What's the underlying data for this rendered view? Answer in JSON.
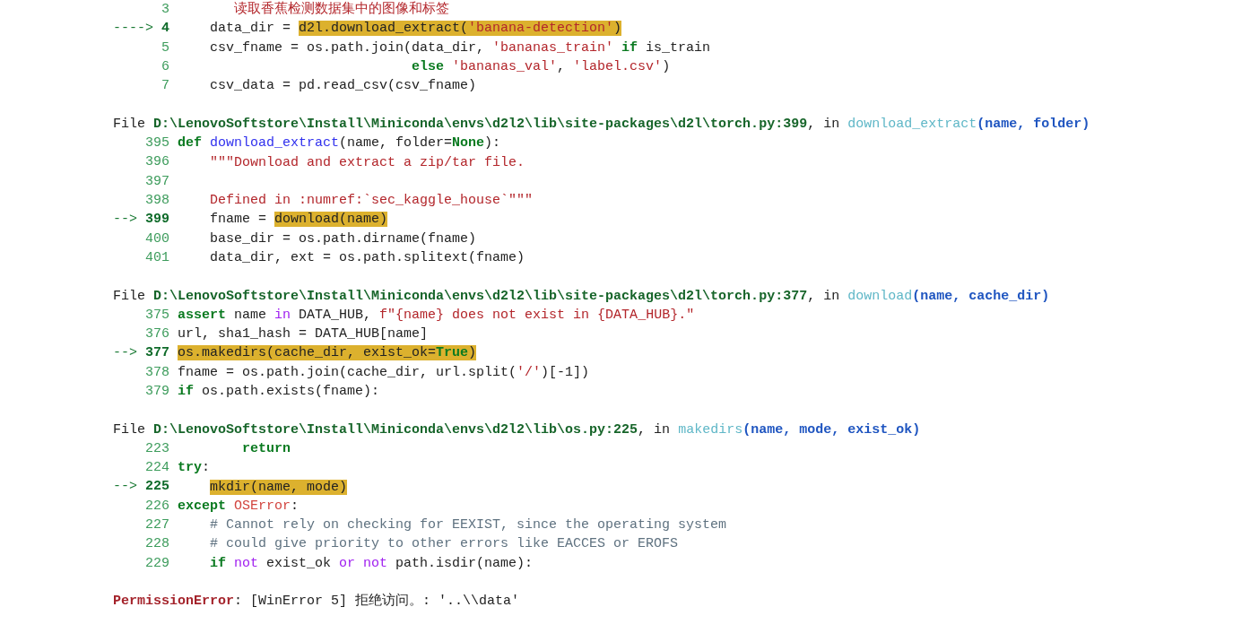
{
  "lines": [
    {
      "kind": "code",
      "current": false,
      "number": "3",
      "code": [
        {
          "kind": "s",
          "text": "       读取香蕉检测数据集中的图像和标签"
        }
      ]
    },
    {
      "kind": "code",
      "current": true,
      "arrow": "---->",
      "number": "4",
      "code": [
        {
          "kind": "p",
          "text": "    data_dir = "
        }
      ],
      "highlight": [
        {
          "kind": "p",
          "text": "d2l.download_extract("
        },
        {
          "kind": "s",
          "text": "'banana-detection'"
        },
        {
          "kind": "p",
          "text": ")"
        }
      ]
    },
    {
      "kind": "code",
      "current": false,
      "number": "5",
      "code": [
        {
          "kind": "p",
          "text": "    csv_fname = os.path.join(data_dir, "
        },
        {
          "kind": "s",
          "text": "'bananas_train'"
        },
        {
          "kind": "kw",
          "text": " if"
        },
        {
          "kind": "p",
          "text": " is_train"
        }
      ]
    },
    {
      "kind": "code",
      "current": false,
      "number": "6",
      "code": [
        {
          "kind": "kw",
          "text": "                             else"
        },
        {
          "kind": "s",
          "text": " 'bananas_val'"
        },
        {
          "kind": "p",
          "text": ", "
        },
        {
          "kind": "s",
          "text": "'label.csv'"
        },
        {
          "kind": "p",
          "text": ")"
        }
      ]
    },
    {
      "kind": "code",
      "current": false,
      "number": "7",
      "code": [
        {
          "kind": "p",
          "text": "    csv_data = pd.read_csv(csv_fname)"
        }
      ]
    },
    {
      "kind": "blank"
    },
    {
      "kind": "header",
      "code": [
        {
          "kind": "p",
          "text": "File "
        },
        {
          "kind": "path",
          "text": "D:\\LenovoSoftstore\\Install\\Miniconda\\envs\\d2l2\\lib\\site-packages\\d2l\\torch.py:399"
        },
        {
          "kind": "p",
          "text": ", in "
        },
        {
          "kind": "tfn",
          "text": "download_extract"
        },
        {
          "kind": "args",
          "text": "(name, folder)"
        }
      ]
    },
    {
      "kind": "code",
      "current": false,
      "number": "395",
      "code": [
        {
          "kind": "kw",
          "text": "def"
        },
        {
          "kind": "fn",
          "text": " download_extract"
        },
        {
          "kind": "p",
          "text": "(name, folder="
        },
        {
          "kind": "kw",
          "text": "None"
        },
        {
          "kind": "p",
          "text": "):"
        }
      ]
    },
    {
      "kind": "code",
      "current": false,
      "number": "396",
      "code": [
        {
          "kind": "s",
          "text": "    \"\"\"Download and extract a zip/tar file."
        }
      ]
    },
    {
      "kind": "code",
      "current": false,
      "number": "397"
    },
    {
      "kind": "code",
      "current": false,
      "number": "398",
      "code": [
        {
          "kind": "s",
          "text": "    Defined in :numref:`sec_kaggle_house`\"\"\""
        }
      ]
    },
    {
      "kind": "code",
      "current": true,
      "arrow": "-->",
      "number": "399",
      "code": [
        {
          "kind": "p",
          "text": "    fname = "
        }
      ],
      "highlight": [
        {
          "kind": "p",
          "text": "download(name)"
        }
      ]
    },
    {
      "kind": "code",
      "current": false,
      "number": "400",
      "code": [
        {
          "kind": "p",
          "text": "    base_dir = os.path.dirname(fname)"
        }
      ]
    },
    {
      "kind": "code",
      "current": false,
      "number": "401",
      "code": [
        {
          "kind": "p",
          "text": "    data_dir, ext = os.path.splitext(fname)"
        }
      ]
    },
    {
      "kind": "blank"
    },
    {
      "kind": "header",
      "code": [
        {
          "kind": "p",
          "text": "File "
        },
        {
          "kind": "path",
          "text": "D:\\LenovoSoftstore\\Install\\Miniconda\\envs\\d2l2\\lib\\site-packages\\d2l\\torch.py:377"
        },
        {
          "kind": "p",
          "text": ", in "
        },
        {
          "kind": "tfn",
          "text": "download"
        },
        {
          "kind": "args",
          "text": "(name, cache_dir)"
        }
      ]
    },
    {
      "kind": "code",
      "current": false,
      "number": "375",
      "code": [
        {
          "kind": "kw",
          "text": "assert"
        },
        {
          "kind": "p",
          "text": " name "
        },
        {
          "kind": "op",
          "text": "in"
        },
        {
          "kind": "p",
          "text": " DATA_HUB, "
        },
        {
          "kind": "s",
          "text": "f\"{name} does not exist in {DATA_HUB}.\""
        }
      ]
    },
    {
      "kind": "code",
      "current": false,
      "number": "376",
      "code": [
        {
          "kind": "p",
          "text": "url, sha1_hash = DATA_HUB[name]"
        }
      ]
    },
    {
      "kind": "code",
      "current": true,
      "arrow": "-->",
      "number": "377",
      "highlight": [
        {
          "kind": "p",
          "text": "os.makedirs(cache_dir, exist_ok="
        },
        {
          "kind": "kw",
          "text": "True"
        },
        {
          "kind": "p",
          "text": ")"
        }
      ]
    },
    {
      "kind": "code",
      "current": false,
      "number": "378",
      "code": [
        {
          "kind": "p",
          "text": "fname = os.path.join(cache_dir, url.split("
        },
        {
          "kind": "s",
          "text": "'/'"
        },
        {
          "kind": "p",
          "text": ")[-1])"
        }
      ]
    },
    {
      "kind": "code",
      "current": false,
      "number": "379",
      "code": [
        {
          "kind": "kw",
          "text": "if"
        },
        {
          "kind": "p",
          "text": " os.path.exists(fname):"
        }
      ]
    },
    {
      "kind": "blank"
    },
    {
      "kind": "header",
      "code": [
        {
          "kind": "p",
          "text": "File "
        },
        {
          "kind": "path",
          "text": "D:\\LenovoSoftstore\\Install\\Miniconda\\envs\\d2l2\\lib\\os.py:225"
        },
        {
          "kind": "p",
          "text": ", in "
        },
        {
          "kind": "tfn",
          "text": "makedirs"
        },
        {
          "kind": "args",
          "text": "(name, mode, exist_ok)"
        }
      ]
    },
    {
      "kind": "code",
      "current": false,
      "number": "223",
      "code": [
        {
          "kind": "kw",
          "text": "        return"
        }
      ]
    },
    {
      "kind": "code",
      "current": false,
      "number": "224",
      "code": [
        {
          "kind": "kw",
          "text": "try"
        },
        {
          "kind": "p",
          "text": ":"
        }
      ]
    },
    {
      "kind": "code",
      "current": true,
      "arrow": "-->",
      "number": "225",
      "highlight": [
        {
          "kind": "p",
          "text": "    mkdir(name, mode)"
        }
      ]
    },
    {
      "kind": "code",
      "current": false,
      "number": "226",
      "code": [
        {
          "kind": "kw",
          "text": "except"
        },
        {
          "kind": "exc",
          "text": " OSError"
        },
        {
          "kind": "p",
          "text": ":"
        }
      ]
    },
    {
      "kind": "code",
      "current": false,
      "number": "227",
      "code": [
        {
          "kind": "c",
          "text": "    # Cannot rely on checking for EEXIST, since the operating system"
        }
      ]
    },
    {
      "kind": "code",
      "current": false,
      "number": "228",
      "code": [
        {
          "kind": "c",
          "text": "    # could give priority to other errors like EACCES or EROFS"
        }
      ]
    },
    {
      "kind": "code",
      "current": false,
      "number": "229",
      "code": [
        {
          "kind": "kw",
          "text": "    if"
        },
        {
          "kind": "op",
          "text": " not"
        },
        {
          "kind": "p",
          "text": " exist_ok "
        },
        {
          "kind": "op",
          "text": "or"
        },
        {
          "kind": "op",
          "text": " not"
        },
        {
          "kind": "p",
          "text": " path.isdir(name):"
        }
      ]
    },
    {
      "kind": "blank"
    },
    {
      "kind": "error",
      "code": [
        {
          "kind": "ename",
          "text": "PermissionError"
        },
        {
          "kind": "p",
          "text": ": [WinError 5] 拒绝访问。: '..\\\\data'"
        }
      ]
    }
  ]
}
